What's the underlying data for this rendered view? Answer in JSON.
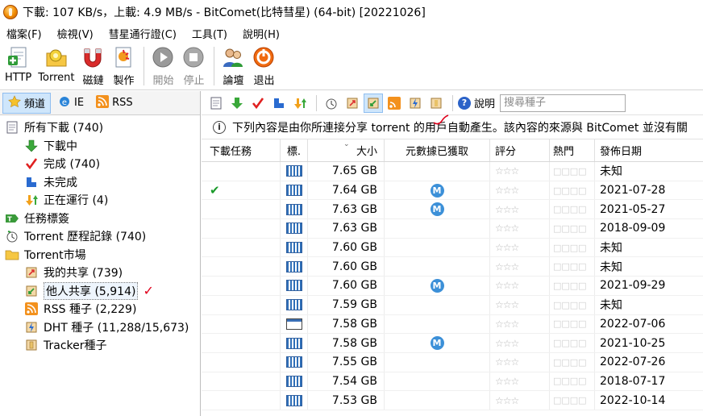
{
  "window": {
    "title": "下載: 107 KB/s，上載: 4.9 MB/s - BitComet(比特彗星) (64-bit) [20221026]"
  },
  "menu": [
    {
      "label": "檔案(F)"
    },
    {
      "label": "檢視(V)"
    },
    {
      "label": "彗星通行證(C)"
    },
    {
      "label": "工具(T)"
    },
    {
      "label": "說明(H)"
    }
  ],
  "toolbar": {
    "buttons": [
      {
        "label": "HTTP",
        "icon": "http-add-icon",
        "disabled": false
      },
      {
        "label": "Torrent",
        "icon": "torrent-add-icon",
        "disabled": false
      },
      {
        "label": "磁鏈",
        "icon": "magnet-icon",
        "disabled": false
      },
      {
        "label": "製作",
        "icon": "make-torrent-icon",
        "disabled": false
      },
      {
        "label": "開始",
        "icon": "start-icon",
        "disabled": true
      },
      {
        "label": "停止",
        "icon": "stop-icon",
        "disabled": true
      },
      {
        "label": "論壇",
        "icon": "forum-icon",
        "disabled": false
      },
      {
        "label": "退出",
        "icon": "exit-icon",
        "disabled": false
      }
    ]
  },
  "left_tabs": [
    {
      "label": "頻道",
      "icon": "star-icon"
    },
    {
      "label": "IE",
      "icon": "ie-icon"
    },
    {
      "label": "RSS",
      "icon": "rss-icon"
    }
  ],
  "tree": [
    {
      "label": "所有下載 (740)",
      "icon": "all-downloads-icon",
      "level": 0
    },
    {
      "label": "下載中",
      "icon": "downloading-icon",
      "level": 1
    },
    {
      "label": "完成 (740)",
      "icon": "completed-icon",
      "level": 1
    },
    {
      "label": "未完成",
      "icon": "incomplete-icon",
      "level": 1
    },
    {
      "label": "正在運行 (4)",
      "icon": "running-icon",
      "level": 1
    },
    {
      "label": "任務標簽",
      "icon": "task-tag-icon",
      "level": 0
    },
    {
      "label": "Torrent 歷程記錄 (740)",
      "icon": "history-icon",
      "level": 0
    },
    {
      "label": "Torrent市場",
      "icon": "folder-icon",
      "level": 0
    },
    {
      "label": "我的共享 (739)",
      "icon": "my-share-icon",
      "level": 1
    },
    {
      "label": "他人共享 (5,914)",
      "icon": "others-share-icon",
      "level": 1,
      "selected": true
    },
    {
      "label": "RSS 種子 (2,229)",
      "icon": "rss-icon",
      "level": 1
    },
    {
      "label": "DHT 種子 (11,288/15,673)",
      "icon": "dht-icon",
      "level": 1
    },
    {
      "label": "Tracker種子",
      "icon": "tracker-icon",
      "level": 1
    }
  ],
  "search": {
    "placeholder": "搜尋種子"
  },
  "help_label": "說明",
  "info_text": "下列內容是由你所連接分享 torrent 的用戶自動產生。該內容的來源與 BitComet 並沒有關",
  "columns": [
    "下載任務",
    "標.",
    "大小",
    "元數據已獲取",
    "評分",
    "熱門",
    "發佈日期"
  ],
  "rows": [
    {
      "task": "",
      "type": "video",
      "size": "7.65 GB",
      "meta": "",
      "rating": "☆☆☆",
      "hot": "□□□□",
      "date": "未知"
    },
    {
      "task": "✔",
      "type": "video",
      "size": "7.64 GB",
      "meta": "M",
      "rating": "☆☆☆",
      "hot": "□□□□",
      "date": "2021-07-28"
    },
    {
      "task": "",
      "type": "video",
      "size": "7.63 GB",
      "meta": "M",
      "rating": "☆☆☆",
      "hot": "□□□□",
      "date": "2021-05-27"
    },
    {
      "task": "",
      "type": "video",
      "size": "7.63 GB",
      "meta": "",
      "rating": "☆☆☆",
      "hot": "□□□□",
      "date": "2018-09-09"
    },
    {
      "task": "",
      "type": "video",
      "size": "7.60 GB",
      "meta": "",
      "rating": "☆☆☆",
      "hot": "□□□□",
      "date": "未知"
    },
    {
      "task": "",
      "type": "video",
      "size": "7.60 GB",
      "meta": "",
      "rating": "☆☆☆",
      "hot": "□□□□",
      "date": "未知"
    },
    {
      "task": "",
      "type": "video",
      "size": "7.60 GB",
      "meta": "M",
      "rating": "☆☆☆",
      "hot": "□□□□",
      "date": "2021-09-29"
    },
    {
      "task": "",
      "type": "video",
      "size": "7.59 GB",
      "meta": "",
      "rating": "☆☆☆",
      "hot": "□□□□",
      "date": "未知"
    },
    {
      "task": "",
      "type": "window",
      "size": "7.58 GB",
      "meta": "",
      "rating": "☆☆☆",
      "hot": "□□□□",
      "date": "2022-07-06"
    },
    {
      "task": "",
      "type": "video",
      "size": "7.58 GB",
      "meta": "M",
      "rating": "☆☆☆",
      "hot": "□□□□",
      "date": "2021-10-25"
    },
    {
      "task": "",
      "type": "video",
      "size": "7.55 GB",
      "meta": "",
      "rating": "☆☆☆",
      "hot": "□□□□",
      "date": "2022-07-26"
    },
    {
      "task": "",
      "type": "video",
      "size": "7.54 GB",
      "meta": "",
      "rating": "☆☆☆",
      "hot": "□□□□",
      "date": "2018-07-17"
    },
    {
      "task": "",
      "type": "video",
      "size": "7.53 GB",
      "meta": "",
      "rating": "☆☆☆",
      "hot": "□□□□",
      "date": "2022-10-14"
    }
  ],
  "annotation": {
    "tree_mark": "✓",
    "color": "#e0001b"
  }
}
